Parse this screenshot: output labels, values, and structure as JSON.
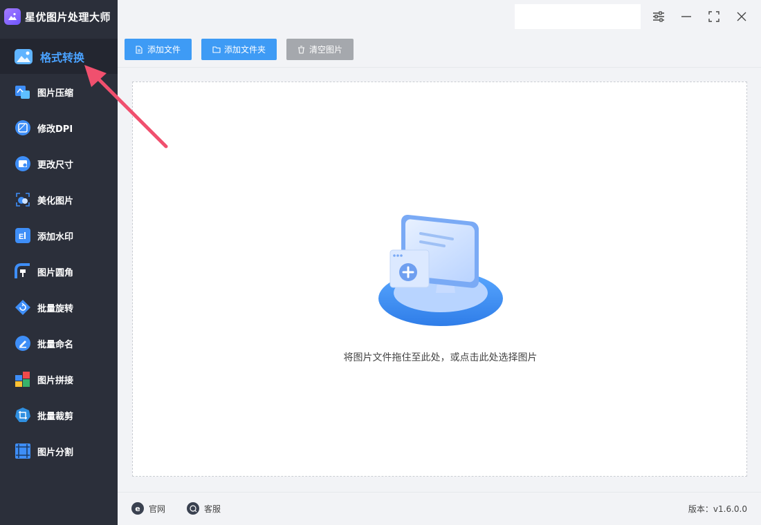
{
  "app": {
    "title": "星优图片处理大师"
  },
  "sidebar": {
    "active": {
      "label": "格式转换",
      "icon": "image-convert-icon"
    },
    "items": [
      {
        "label": "图片压缩",
        "icon": "compress-icon"
      },
      {
        "label": "修改DPI",
        "icon": "dpi-icon"
      },
      {
        "label": "更改尺寸",
        "icon": "resize-icon"
      },
      {
        "label": "美化图片",
        "icon": "beautify-icon"
      },
      {
        "label": "添加水印",
        "icon": "watermark-icon"
      },
      {
        "label": "图片圆角",
        "icon": "rounded-corner-icon"
      },
      {
        "label": "批量旋转",
        "icon": "rotate-icon"
      },
      {
        "label": "批量命名",
        "icon": "rename-icon"
      },
      {
        "label": "图片拼接",
        "icon": "stitch-icon"
      },
      {
        "label": "批量裁剪",
        "icon": "crop-icon"
      },
      {
        "label": "图片分割",
        "icon": "split-icon"
      }
    ]
  },
  "toolbar": {
    "add_file": "添加文件",
    "add_folder": "添加文件夹",
    "clear_images": "清空图片"
  },
  "main": {
    "drop_hint": "将图片文件拖住至此处，或点击此处选择图片"
  },
  "footer": {
    "website": "官网",
    "support": "客服",
    "version": "版本：v1.6.0.0"
  },
  "colors": {
    "sidebar_bg": "#2b2f3a",
    "accent": "#4aa2ff",
    "button_blue": "#3e9bf5",
    "button_gray": "#a5a8ad",
    "annotation_arrow": "#f0506e"
  }
}
